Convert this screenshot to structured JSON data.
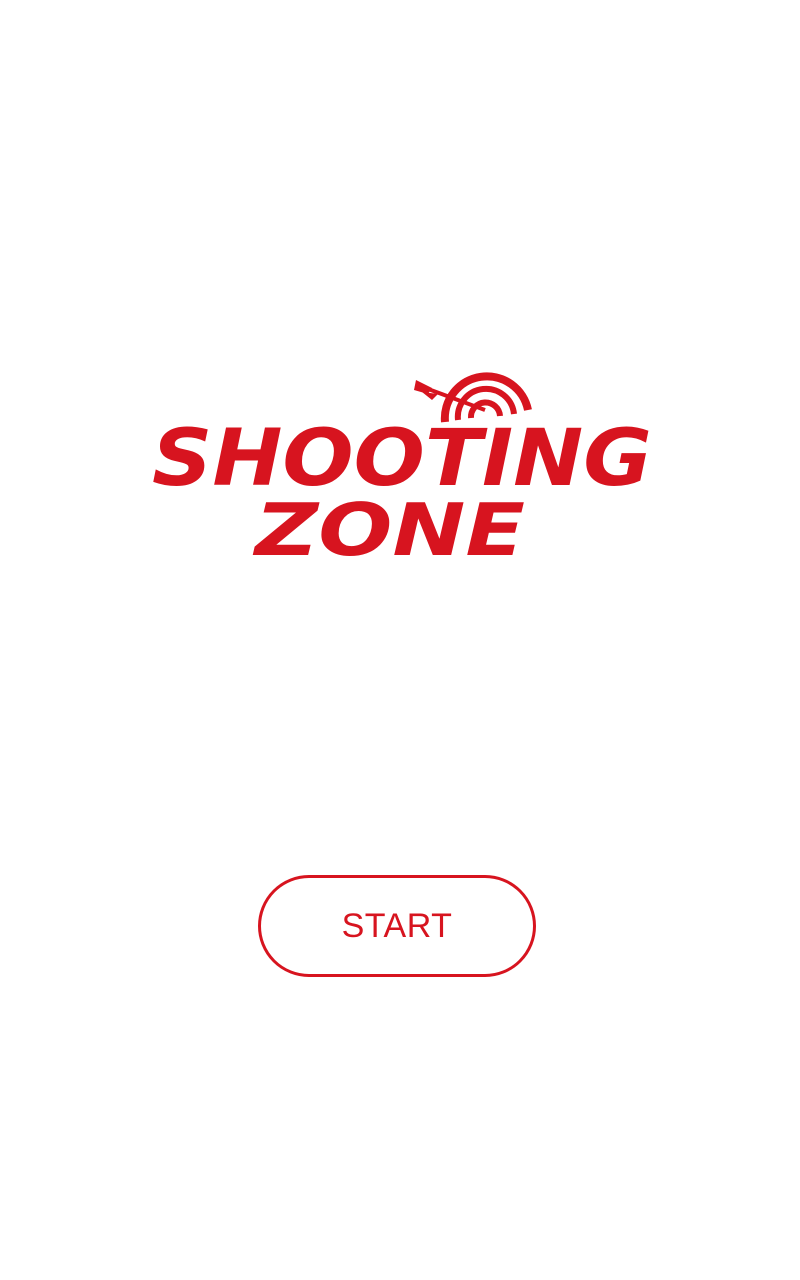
{
  "logo": {
    "line1": "SHOOTING",
    "line2": "ZONE",
    "icon": "target-with-arrow-icon",
    "color": "#d7141f"
  },
  "start_button": {
    "label": "START",
    "color": "#d7141f"
  },
  "background": "#ffffff"
}
